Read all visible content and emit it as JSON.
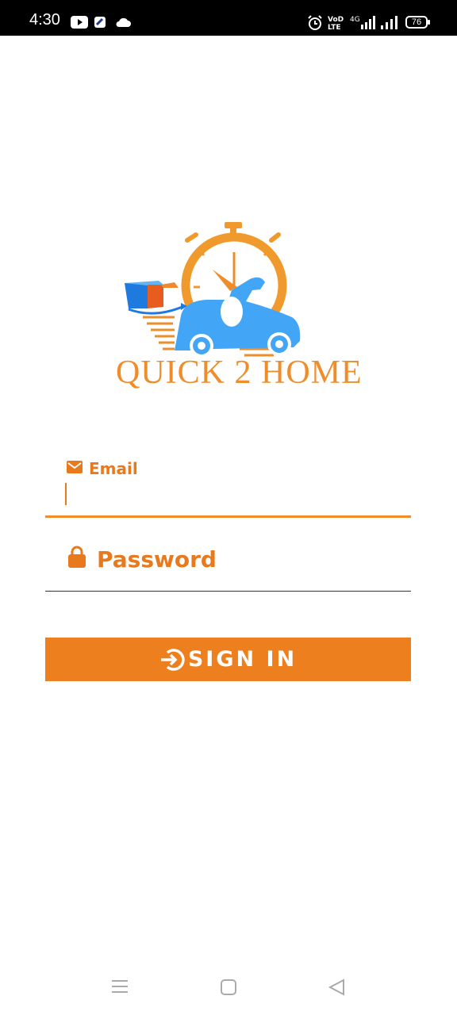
{
  "status_bar": {
    "time": "4:30",
    "battery": "76",
    "icons": [
      "youtube-icon",
      "app-icon",
      "cloud-icon",
      "alarm-icon",
      "volte-icon",
      "signal-4g-icon",
      "signal-icon",
      "battery-icon"
    ]
  },
  "logo": {
    "text": "QUICK 2 HOME",
    "colors": {
      "orange": "#ef8d2b",
      "blue": "#42a5f5"
    }
  },
  "form": {
    "email_label": "Email",
    "email_value": "",
    "password_label": "Password",
    "accent": "#ee7f1e"
  },
  "signin_button": {
    "label": "SIGN IN"
  },
  "nav_bar": {
    "items": [
      "menu-icon",
      "home-icon",
      "back-icon"
    ]
  }
}
